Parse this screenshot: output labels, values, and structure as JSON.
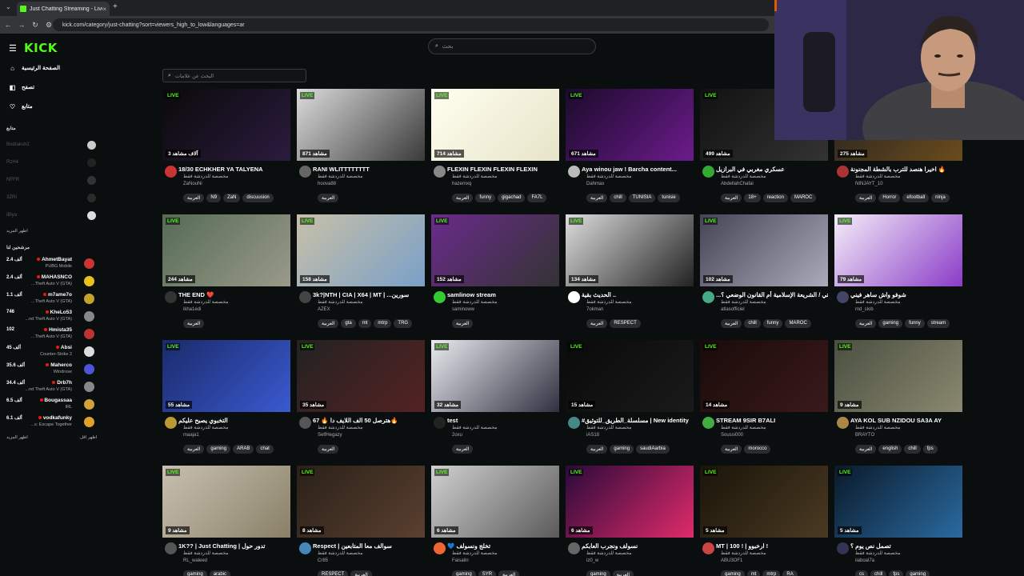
{
  "browser": {
    "tab_title": "Just Chatting Streaming - Live",
    "url": "kick.com/category/just-chatting?sort=viewers_high_to_low&languages=ar",
    "newtab_icon": "+",
    "close_icon": "×"
  },
  "sidebar": {
    "logo": "KICK",
    "nav": [
      {
        "label": "الصفحة الرئيسية",
        "icon": "home-icon"
      },
      {
        "label": "تصفح",
        "icon": "browse-icon"
      },
      {
        "label": "متابع",
        "icon": "heart-icon"
      }
    ],
    "following_title": "متابع",
    "following": [
      "Bodraksh2",
      "RzH4",
      "NFFR",
      "3ZRI",
      "iBiya"
    ],
    "following_more": "اظهر المزيد",
    "recommended_title": "مرشحين لنا",
    "recommended": [
      {
        "count": "2.4 ألف",
        "name": "AhmetBayat",
        "category": "PUBG Mobile"
      },
      {
        "count": "2.4 ألف",
        "name": "MAHASNCO",
        "category": "...Theft Auto V (GTA)"
      },
      {
        "count": "1.1 ألف",
        "name": "m7ame7o",
        "category": "...Theft Auto V (GTA)"
      },
      {
        "count": "746",
        "name": "KheLo53",
        "category": "...nd Theft Auto V (GTA)"
      },
      {
        "count": "102",
        "name": "Hmista35",
        "category": "...Theft Auto V (GTA)"
      },
      {
        "count": "45 ألف",
        "name": "Absi",
        "category": "Counter-Strike 2"
      },
      {
        "count": "35.6 ألف",
        "name": "Maherco",
        "category": "Windrose"
      },
      {
        "count": "34.4 ألف",
        "name": "Drb7h",
        "category": "...nd Theft Auto V (GTA)"
      },
      {
        "count": "6.5 ألف",
        "name": "Bougassaa",
        "category": "IRL"
      },
      {
        "count": "6.1 ألف",
        "name": "vodkafunky",
        "category": "...s: Escape Together"
      }
    ],
    "more_left": "اظهر المزيد",
    "more_right": "اظهر اقل"
  },
  "search": {
    "placeholder": "بحث"
  },
  "tag_search": {
    "placeholder": "البحث عن علامات"
  },
  "cards": [
    {
      "viewers": "3 آلاف مشاهد",
      "title": "18/30 ECHKHER YA TALYENA",
      "user": "ZaNouNi",
      "tags": [
        "العربية",
        "N9",
        "ZaN",
        "discuusion"
      ]
    },
    {
      "viewers": "871 مشاهد",
      "title": "RANI WLITTTTTTTT",
      "user": "hoova88",
      "tags": [
        "العربية"
      ]
    },
    {
      "viewers": "714 مشاهد",
      "title": "FLEXIN FLEXIN FLEXIN FLEXIN",
      "user": "hazemxq",
      "tags": [
        "العربية",
        "funny",
        "gigachad",
        "FA7L"
      ]
    },
    {
      "viewers": "671 مشاهد",
      "title": "Aya winou jaw ! Barcha content...",
      "user": "Dahmax",
      "tags": [
        "العربية",
        "chill",
        "TUNISIA",
        "tunisie"
      ]
    },
    {
      "viewers": "499 مشاهد",
      "title": "عسكري مغربي في البرازيل",
      "user": "AbdellahChafai",
      "tags": [
        "العربية",
        "18+",
        "reaction",
        "MAROC"
      ]
    },
    {
      "viewers": "275 مشاهد",
      "title": "اخيرا هنصد للترب بالشطة المجنونة 🔥",
      "user": "NINJAYT_10",
      "tags": [
        "العربية",
        "Horror",
        "efootball",
        "ninja"
      ]
    },
    {
      "viewers": "244 مشاهد",
      "title": "THE END ❤️",
      "user": "ikha1edi",
      "tags": [
        "العربية"
      ]
    },
    {
      "viewers": "158 مشاهد",
      "title": "3k?|NTH | CIA | X64 | MT | ...سورين",
      "user": "AZEX",
      "tags": [
        "العربية",
        "gta",
        "mt",
        "mtrp",
        "TRG"
      ]
    },
    {
      "viewers": "152 مشاهد",
      "title": "samlinow stream",
      "user": "saminoww",
      "tags": [
        "العربية"
      ]
    },
    {
      "viewers": "134 مشاهد",
      "title": "الحديث بقية ..",
      "user": "7okman",
      "tags": [
        "العربية",
        "RESPECT"
      ]
    },
    {
      "viewers": "102 مشاهد",
      "title": "...اتي / الشريعة الإسلامية أم القانون الوضعي ؟",
      "user": "atlasofficiel",
      "tags": [
        "العربية",
        "chill",
        "funny",
        "MAROC"
      ]
    },
    {
      "viewers": "79 مشاهد",
      "title": "شوفو واش ساهر فيني",
      "user": "md_slob",
      "tags": [
        "العربية",
        "gaming",
        "funny",
        "stream"
      ]
    },
    {
      "viewers": "55 مشاهد",
      "title": "التخبوي يصبح عليكم",
      "user": "maaja1",
      "tags": [
        "العربية",
        "gaming",
        "ARAB",
        "chat"
      ]
    },
    {
      "viewers": "35 مشاهد",
      "title": "67 🔥 هترصل 50 الف اللايف دا🔥",
      "user": "SelfHegazy",
      "tags": [
        "العربية"
      ]
    },
    {
      "viewers": "32 مشاهد",
      "title": "test",
      "user": "2oxu",
      "tags": [
        "العربية"
      ]
    },
    {
      "viewers": "15 مشاهد",
      "title": "#مسلسلة_الطريق_للتوثيق | New identity",
      "user": "iAS18",
      "tags": [
        "العربية",
        "gaming",
        "saudiAarbia"
      ]
    },
    {
      "viewers": "14 مشاهد",
      "title": "STREAM 9SIR B7ALI",
      "user": "Soussi000",
      "tags": [
        "العربية",
        "morocco"
      ]
    },
    {
      "viewers": "9 مشاهد",
      "title": "AYA KOL SUB NZIDOU SA3A AY",
      "user": "BRAYTO",
      "tags": [
        "العربية",
        "english",
        "chill",
        "fps"
      ]
    },
    {
      "viewers": "9 مشاهد",
      "title": "1K?? | Just Chatting | تدور حول",
      "user": "RL_waleed",
      "tags": [
        "gaming",
        "arabic"
      ]
    },
    {
      "viewers": "8 مشاهد",
      "title": "Respect | سوالف معا المتابعين",
      "user": "Cr85",
      "tags": [
        "RESPECT",
        "العربية"
      ]
    },
    {
      "viewers": "6 مشاهد",
      "title": "💙 تخلج ونسولف",
      "user": "Faisalin",
      "tags": [
        "gaming",
        "SYR",
        "العربية"
      ]
    },
    {
      "viewers": "6 مشاهد",
      "title": "نسولف ونجرب العابكم",
      "user": "iz0_w",
      "tags": [
        "gaming",
        "العربية"
      ]
    },
    {
      "viewers": "5 مشاهد",
      "title": "MT | 100 ! | ارخبوو !",
      "user": "ABU3OF1",
      "tags": [
        "gaming",
        "mt",
        "mtrp",
        "RA"
      ]
    },
    {
      "viewers": "5 مشاهد",
      "title": "تصمل نص يوم ؟",
      "user": "iiaboal7a",
      "tags": [
        "cs",
        "chill",
        "fps",
        "gaming"
      ]
    }
  ],
  "card_shared": {
    "live_label": "LIVE",
    "subtitle": "مخصصة للدردشة فقط"
  },
  "colors": {
    "brand": "#53fc18",
    "bg": "#0b0e0f",
    "live_dot": "#e91916"
  }
}
